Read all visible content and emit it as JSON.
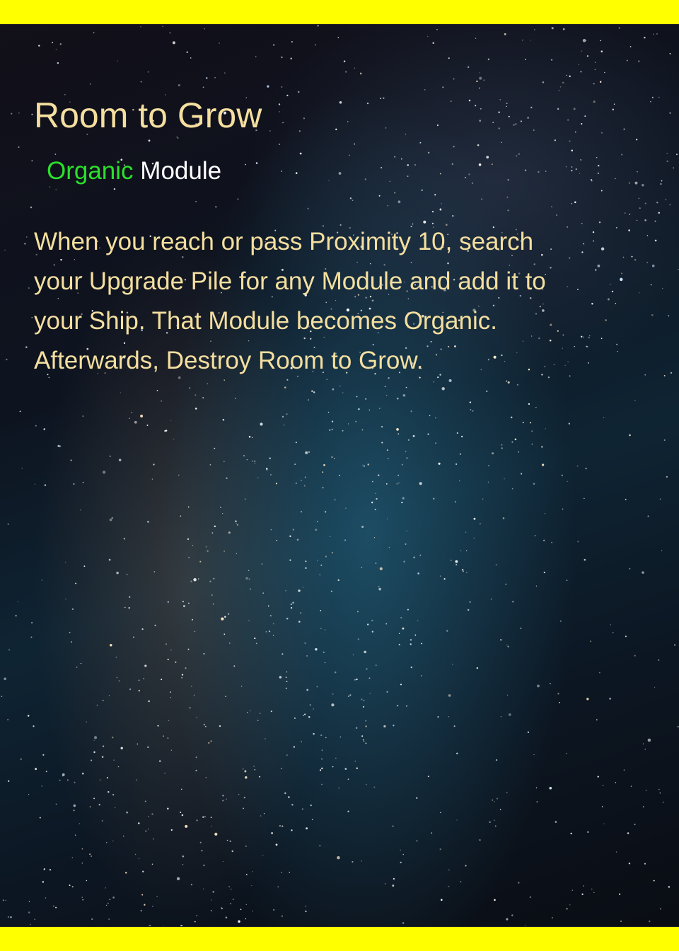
{
  "card": {
    "title": "Room to Grow",
    "keyword": "Organic",
    "card_type": "Module",
    "rules_lines": [
      "When you reach or pass Proximity 10, search",
      "your Upgrade Pile for any Module and add it to",
      "your Ship. That Module becomes Organic.",
      "Afterwards, Destroy Room to Grow."
    ]
  },
  "colors": {
    "border_band": "#ffff00",
    "title_text": "#f4df9f",
    "keyword_text": "#2be02b",
    "type_text": "#ffffff",
    "rules_text": "#f4df9f"
  },
  "background": "starfield-milky-way"
}
